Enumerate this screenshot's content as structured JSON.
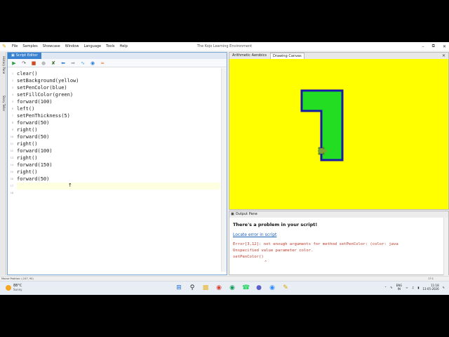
{
  "window": {
    "title": "The Kojo Learning Environment",
    "menu": [
      "File",
      "Samples",
      "Showcase",
      "Window",
      "Language",
      "Tools",
      "Help"
    ],
    "controls": [
      "–",
      "⧉",
      "✕"
    ]
  },
  "left_tabs": {
    "history": "History Pane",
    "story": "Story Teller"
  },
  "editor": {
    "tab_label": "Script Editor",
    "toolbar_icons": [
      "run-icon",
      "trace-icon",
      "stop-icon",
      "clear-output-icon",
      "format-icon",
      "undo-icon",
      "redo-icon",
      "zoom-icon",
      "upload-icon",
      "help-icon"
    ],
    "line_numbers": [
      "1",
      "2",
      "3",
      "4",
      "5",
      "6",
      "7",
      "8",
      "9",
      "10",
      "11",
      "12",
      "13",
      "14",
      "15",
      "16",
      "17",
      "18"
    ],
    "code_lines": [
      "clear()",
      "setBackground(yellow)",
      "setPenColor(blue)",
      "setFillColor(green)",
      "forward(100)",
      "left()",
      "setPenThickness(5)",
      "forward(50)",
      "right()",
      "forward(50)",
      "right()",
      "forward(100)",
      "right()",
      "forward(150)",
      "right()",
      "forward(50)",
      "",
      ""
    ]
  },
  "canvas": {
    "tabs": [
      "Arithmetic Aerobics",
      "Drawing Canvas"
    ],
    "active_tab": "Drawing Canvas",
    "background_color": "#ffff00",
    "pen_color": "#1a1aa8",
    "fill_color": "#22dd22"
  },
  "output": {
    "pane_label": "Output Pane",
    "heading": "There's a problem in your script!",
    "link": "Locate error in script",
    "error_lines": [
      "Error[3,12]: not enough arguments for method setPenColor: (color: java",
      "Unspecified value parameter color.",
      "setPenColor()"
    ],
    "caret": "^",
    "error_color": "#c0392b"
  },
  "status_bar": {
    "left": "Mouse Position: (-247, 90)",
    "right": "17:1"
  },
  "taskbar": {
    "weather_temp": "88°C",
    "weather_cond": "Sunny",
    "lang_top": "ENG",
    "lang_bottom": "IN",
    "time": "11:18",
    "date": "13-05-2026"
  }
}
